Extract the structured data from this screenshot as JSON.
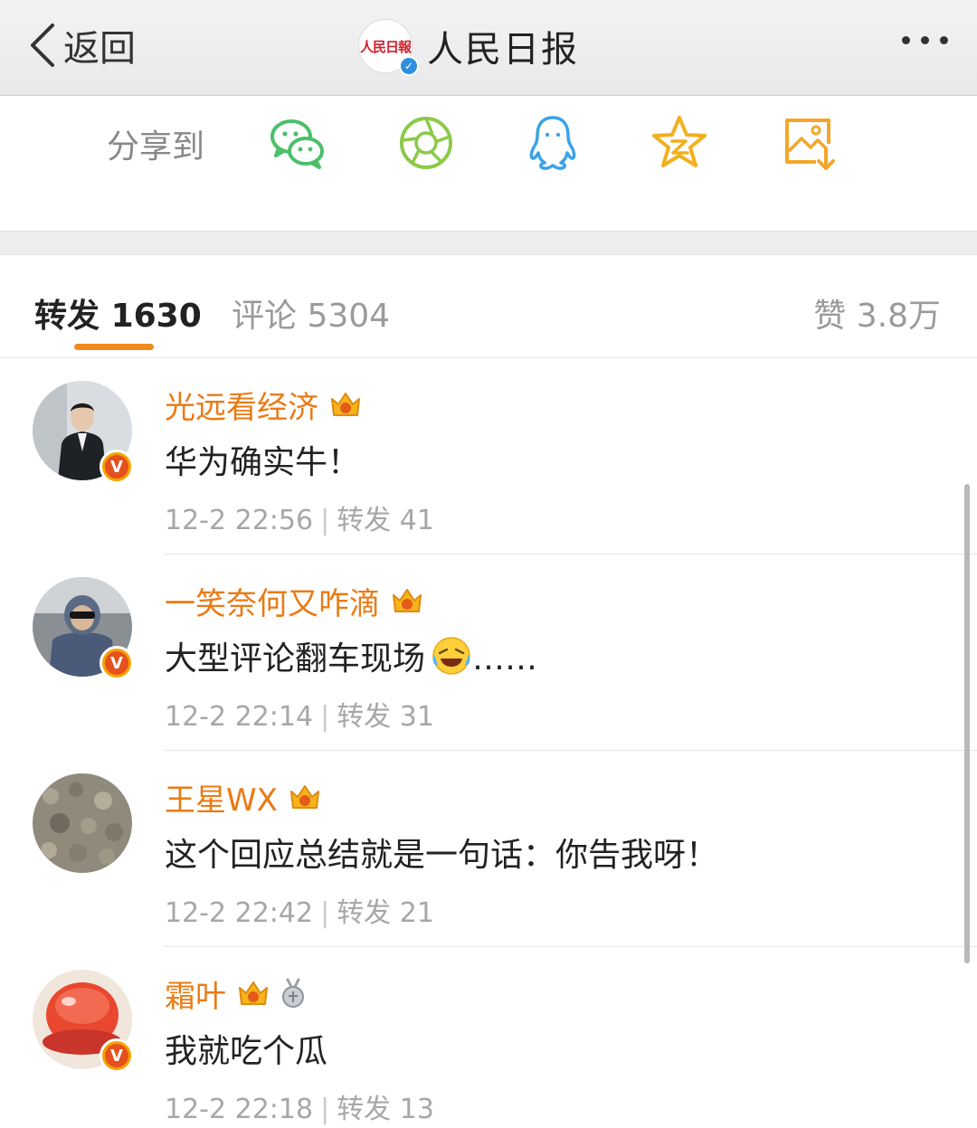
{
  "navbar": {
    "back_label": "返回",
    "account_name": "人民日报",
    "logo_text": "人民日報",
    "verified_mark": "✓"
  },
  "share": {
    "label": "分享到",
    "targets": [
      "wechat-icon",
      "moments-icon",
      "qq-icon",
      "qzone-icon",
      "save-image-icon"
    ]
  },
  "tabs": {
    "repost": {
      "label": "转发",
      "count": "1630"
    },
    "comments": {
      "label": "评论",
      "count": "5304"
    },
    "likes": {
      "label": "赞",
      "count": "3.8万"
    }
  },
  "colors": {
    "accent": "#ea7a14",
    "underline": "#f08a1c",
    "meta_text": "#a7a7a7"
  },
  "items": [
    {
      "user": "光远看经济",
      "text": "华为确实牛！",
      "time": "12-2 22:56",
      "repost_label": "转发",
      "repost_count": "41"
    },
    {
      "user": "一笑奈何又咋滴",
      "text": "大型评论翻车现场",
      "text_suffix": "……",
      "time": "12-2 22:14",
      "repost_label": "转发",
      "repost_count": "31"
    },
    {
      "user": "王星WX",
      "text": "这个回应总结就是一句话：你告我呀！",
      "time": "12-2 22:42",
      "repost_label": "转发",
      "repost_count": "21"
    },
    {
      "user": "霜叶",
      "text": "我就吃个瓜",
      "time": "12-2 22:18",
      "repost_label": "转发",
      "repost_count": "13"
    }
  ],
  "badges": {
    "verified_v": "V"
  }
}
